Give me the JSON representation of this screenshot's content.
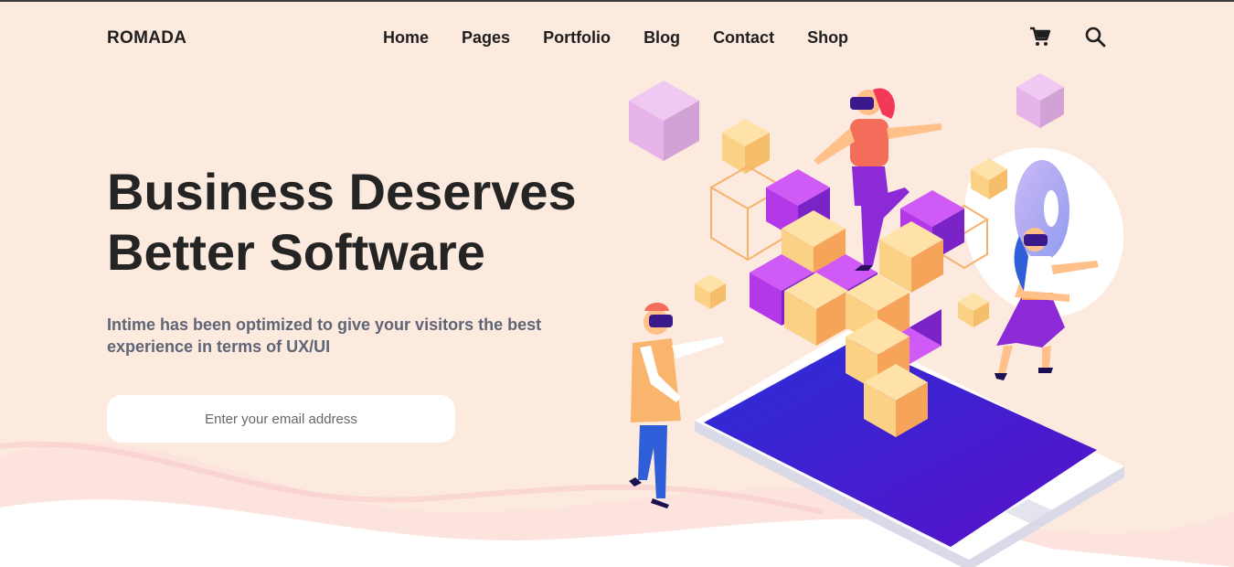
{
  "brand": {
    "name": "ROMADA"
  },
  "nav": {
    "items": [
      {
        "label": "Home"
      },
      {
        "label": "Pages"
      },
      {
        "label": "Portfolio"
      },
      {
        "label": "Blog"
      },
      {
        "label": "Contact"
      },
      {
        "label": "Shop"
      }
    ]
  },
  "header_icons": {
    "cart": "cart-icon",
    "search": "search-icon"
  },
  "hero": {
    "title_line1": "Business Deserves",
    "title_line2": "Better Software",
    "subtitle": "Intime has been optimized to give your visitors the best experience in terms of UX/UI",
    "email_placeholder": "Enter your email address"
  },
  "colors": {
    "background": "#fdeade",
    "heading": "#242424",
    "subtitle": "#5f6577",
    "phone_screen": "#3a2bd6",
    "cube_purple": "#b238e8",
    "cube_yellow": "#fdc55e",
    "cube_pink": "#e8b6ea"
  }
}
